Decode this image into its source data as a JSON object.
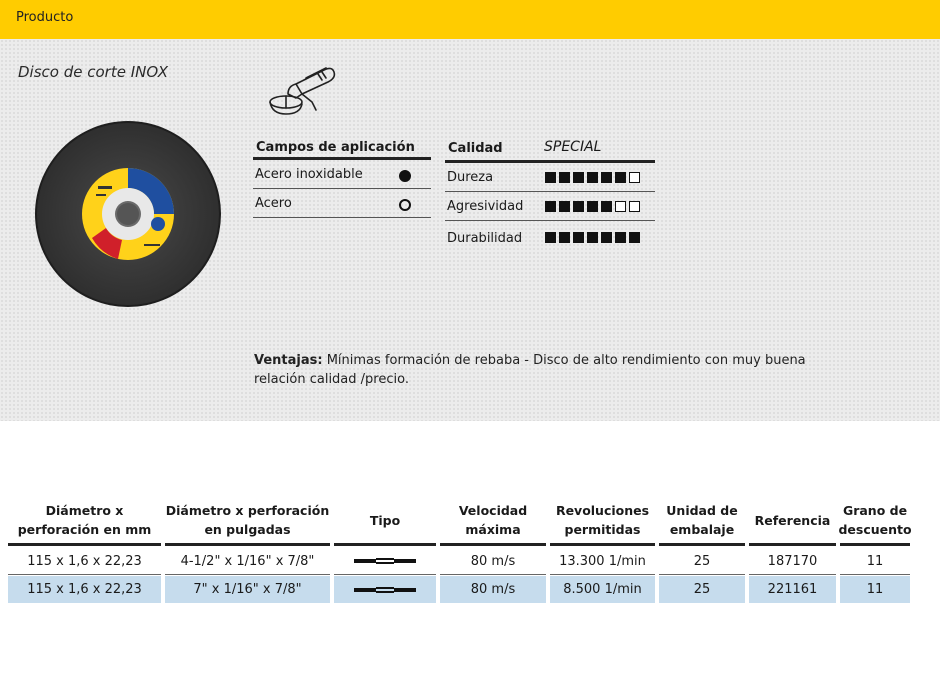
{
  "header": {
    "label": "Producto"
  },
  "product": {
    "title": "Disco de corte INOX"
  },
  "application": {
    "heading": "Campos de aplicación",
    "rows": [
      {
        "label": "Acero inoxidable",
        "mark": "filled-circle-icon"
      },
      {
        "label": "Acero",
        "mark": "empty-circle-icon"
      }
    ]
  },
  "quality": {
    "heading": "Calidad",
    "grade": "SPECIAL",
    "rows": [
      {
        "label": "Dureza",
        "level": 6,
        "max": 7
      },
      {
        "label": "Agresividad",
        "level": 5,
        "max": 7
      },
      {
        "label": "Durabilidad",
        "level": 7,
        "max": 7
      }
    ]
  },
  "advantages": {
    "label": "Ventajas:",
    "text": "Mínimas formación de rebaba - Disco de alto rendimiento con muy buena relación calidad /precio."
  },
  "specs": {
    "headers": [
      "Diámetro x perforación en mm",
      "Diámetro x perforación en pulgadas",
      "Tipo",
      "Velocidad máxima",
      "Revoluciones permitidas",
      "Unidad de embalaje",
      "Referencia",
      "Grano de descuento"
    ],
    "rows": [
      {
        "mm": "115 x 1,6 x 22,23",
        "inch": "4-1/2\" x 1/16\" x 7/8\"",
        "tipo": "flat-disc-icon",
        "speed": "80 m/s",
        "rpm": "13.300 1/min",
        "unit": "25",
        "ref": "187170",
        "grain": "11"
      },
      {
        "mm": "115 x 1,6 x 22,23",
        "inch": "7\" x 1/16\" x 7/8\"",
        "tipo": "flat-disc-icon",
        "speed": "80 m/s",
        "rpm": "8.500 1/min",
        "unit": "25",
        "ref": "221161",
        "grain": "11"
      }
    ]
  },
  "colors": {
    "accent": "#ffcc00",
    "row_highlight": "#c6dced"
  }
}
